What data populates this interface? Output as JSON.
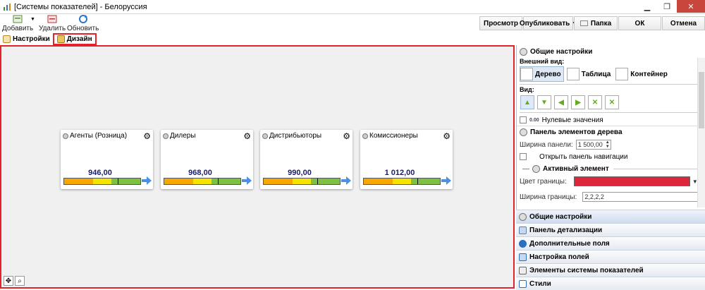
{
  "window": {
    "title": "[Системы показателей] - Белоруссия"
  },
  "toolbar": {
    "add": "Добавить",
    "delete": "Удалить",
    "refresh": "Обновить",
    "preview": "Просмотр",
    "publish": "Опубликовать",
    "folder": "Папка",
    "ok": "ОК",
    "cancel": "Отмена"
  },
  "tabs": [
    {
      "label": "Настройки"
    },
    {
      "label": "Дизайн"
    }
  ],
  "cards": [
    {
      "label": "Агенты (Розница)",
      "value": "946,00"
    },
    {
      "label": "Дилеры",
      "value": "968,00"
    },
    {
      "label": "Дистрибьюторы",
      "value": "990,00"
    },
    {
      "label": "Комиссионеры",
      "value": "1 012,00"
    }
  ],
  "panel": {
    "general_title": "Общие настройки",
    "appearance_label": "Внешний вид:",
    "appearance_options": [
      "Дерево",
      "Таблица",
      "Контейнер"
    ],
    "view_label": "Вид:",
    "zero_values": "Нулевые значения",
    "tree_panel_title": "Панель элементов дерева",
    "panel_width_label": "Ширина панели:",
    "panel_width_value": "1 500,00",
    "open_nav_label": "Открыть панель навигации",
    "active_element_title": "Активный элемент",
    "border_color_label": "Цвет границы:",
    "border_width_label": "Ширина границы:",
    "border_width_value": "2,2,2,2"
  },
  "accordion": [
    "Общие настройки",
    "Панель детализации",
    "Дополнительные поля",
    "Настройка полей",
    "Элементы системы показателей",
    "Стили"
  ],
  "colors": {
    "accent_border": "#e3222b",
    "border_color_value": "#dc2639"
  }
}
